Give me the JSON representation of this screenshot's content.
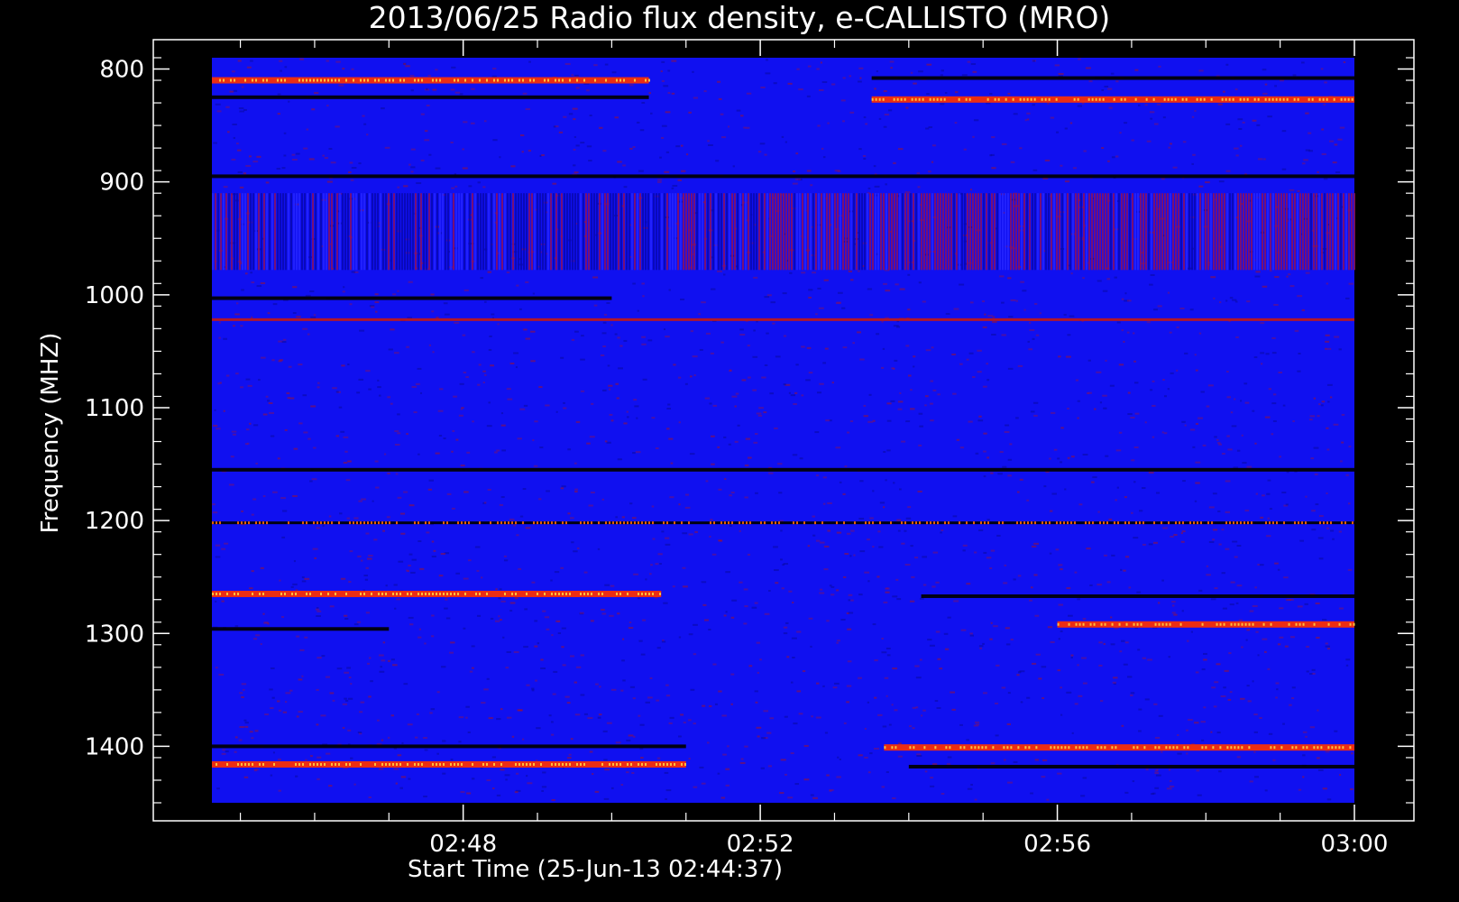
{
  "chart_data": {
    "type": "heatmap",
    "title": "2013/06/25  Radio flux density, e-CALLISTO (MRO)",
    "xlabel": "Start Time (25-Jun-13 02:44:37)",
    "ylabel": "Frequency (MHZ)",
    "x_ticks": [
      "02:48",
      "02:52",
      "02:56",
      "03:00"
    ],
    "y_ticks": [
      "800",
      "900",
      "1000",
      "1100",
      "1200",
      "1300",
      "1400"
    ],
    "x_range": [
      "02:44:37",
      "03:00:00"
    ],
    "ylim": [
      1450,
      790
    ],
    "background_color": "#1010f0",
    "colormap": [
      "#000000",
      "#1010f0",
      "#b01020",
      "#ff3000",
      "#ffff60"
    ],
    "bands": [
      {
        "freq": 810,
        "from": "02:44:37",
        "to": "02:50:30",
        "level": "bright"
      },
      {
        "freq": 827,
        "from": "02:53:30",
        "to": "03:00:00",
        "level": "bright"
      },
      {
        "freq": 808,
        "from": "02:53:30",
        "to": "03:00:00",
        "level": "dark"
      },
      {
        "freq": 825,
        "from": "02:44:37",
        "to": "02:50:30",
        "level": "dark"
      },
      {
        "freq": 895,
        "from": "02:44:37",
        "to": "03:00:00",
        "level": "dark"
      },
      {
        "freq": 1003,
        "from": "02:44:37",
        "to": "02:50:00",
        "level": "dark"
      },
      {
        "freq": 1022,
        "from": "02:44:37",
        "to": "03:00:00",
        "level": "faint"
      },
      {
        "freq": 1155,
        "from": "02:44:37",
        "to": "03:00:00",
        "level": "dark"
      },
      {
        "freq": 1202,
        "from": "02:44:37",
        "to": "03:00:00",
        "level": "mixed"
      },
      {
        "freq": 1265,
        "from": "02:44:37",
        "to": "02:50:40",
        "level": "bright"
      },
      {
        "freq": 1267,
        "from": "02:54:10",
        "to": "03:00:00",
        "level": "dark"
      },
      {
        "freq": 1296,
        "from": "02:44:37",
        "to": "02:47:00",
        "level": "dark"
      },
      {
        "freq": 1292,
        "from": "02:56:00",
        "to": "03:00:00",
        "level": "bright"
      },
      {
        "freq": 1400,
        "from": "02:44:37",
        "to": "02:51:00",
        "level": "dark"
      },
      {
        "freq": 1401,
        "from": "02:53:40",
        "to": "03:00:00",
        "level": "bright"
      },
      {
        "freq": 1416,
        "from": "02:44:37",
        "to": "02:51:00",
        "level": "bright"
      },
      {
        "freq": 1418,
        "from": "02:54:00",
        "to": "03:00:00",
        "level": "dark"
      }
    ],
    "interference_band": {
      "from_freq": 910,
      "to_freq": 978
    }
  }
}
